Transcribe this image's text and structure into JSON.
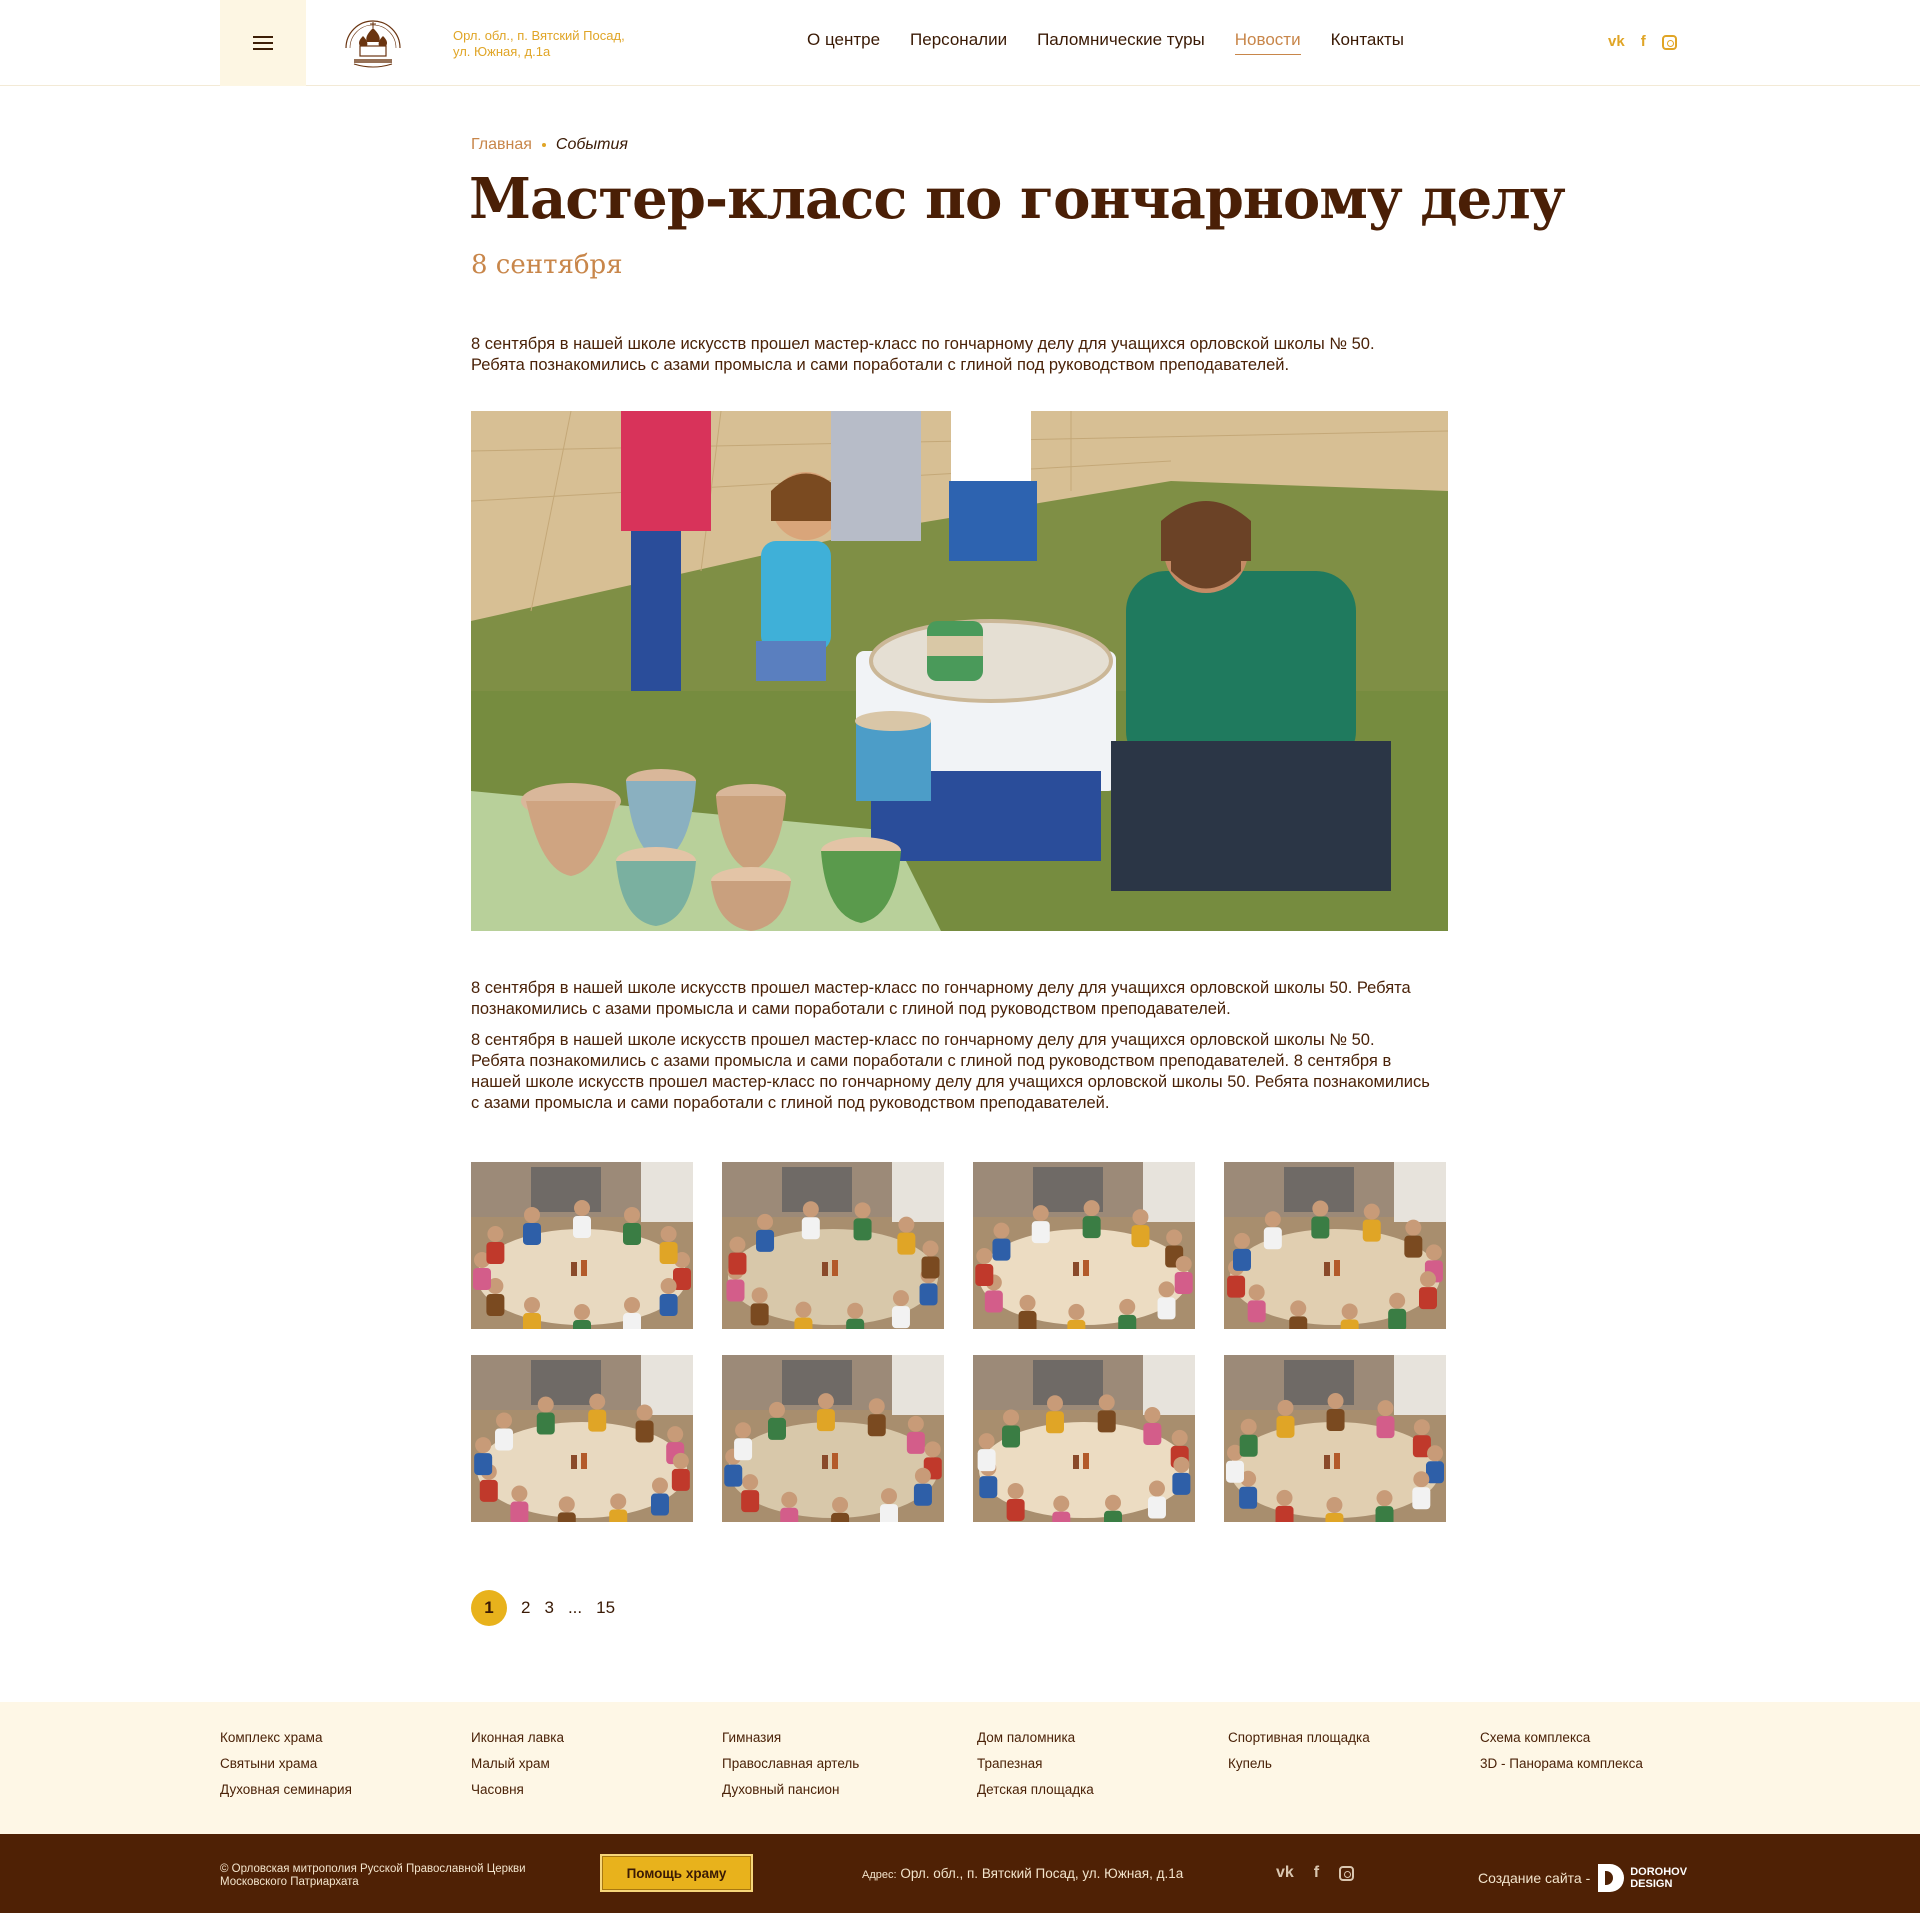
{
  "header": {
    "logo_alt": "Вятский Посад",
    "address": "Орл. обл., п. Вятский Посад, ул. Южная, д.1а",
    "nav": [
      {
        "label": "О центре",
        "active": false
      },
      {
        "label": "Персоналии",
        "active": false
      },
      {
        "label": "Паломнические туры",
        "active": false
      },
      {
        "label": "Новости",
        "active": true
      },
      {
        "label": "Контакты",
        "active": false
      }
    ],
    "social": {
      "vk": "vk",
      "fb": "f"
    }
  },
  "breadcrumb": {
    "home": "Главная",
    "current": "События"
  },
  "article": {
    "title": "Мастер-класс по гончарному делу",
    "date": "8 сентября",
    "p1": "8 сентября в нашей школе искусств прошел мастер-класс по гончарному делу для учащихся орловской школы № 50. Ребята познакомились с азами промысла и сами поработали с глиной под руководством преподавателей.",
    "p2": "8 сентября в нашей школе искусств прошел мастер-класс по гончарному делу для учащихся орловской школы 50. Ребята познакомились с азами промысла и сами поработали с глиной под руководством преподавателей.",
    "p3": "8 сентября в нашей школе искусств прошел мастер-класс по гончарному делу для учащихся орловской школы № 50. Ребята познакомились с азами промысла и сами поработали с глиной под руководством преподавателей. 8 сентября в нашей школе искусств прошел мастер-класс по гончарному делу для учащихся орловской школы 50. Ребята познакомились с азами промысла и сами поработали с глиной под руководством преподавателей."
  },
  "pagination": {
    "current": "1",
    "pages": [
      "2",
      "3"
    ],
    "ellipsis": "...",
    "last": "15"
  },
  "footer_links": [
    [
      "Комплекс храма",
      "Святыни храма",
      "Духовная семинария"
    ],
    [
      "Иконная лавка",
      "Малый храм",
      "Часовня"
    ],
    [
      "Гимназия",
      "Православная артель",
      "Духовный пансион"
    ],
    [
      "Дом паломника",
      "Трапезная",
      "Детская площадка"
    ],
    [
      "Спортивная площадка",
      "Купель"
    ],
    [
      "Схема комплекса",
      "3D - Панорама комплекса"
    ]
  ],
  "footer": {
    "copyright": "© Орловская митрополия Русской Православной Церкви Московского Патриархата",
    "help_button": "Помощь храму",
    "address_label": "Адрес:",
    "address": "Орл. обл., п. Вятский Посад, ул. Южная, д.1а",
    "made_by": "Создание сайта -",
    "studio_line1": "DOROHOV",
    "studio_line2": "DESIGN"
  },
  "colors": {
    "accent": "#e8b21c",
    "brown": "#4f2105",
    "cream": "#fef7e6",
    "link": "#c8864a"
  }
}
